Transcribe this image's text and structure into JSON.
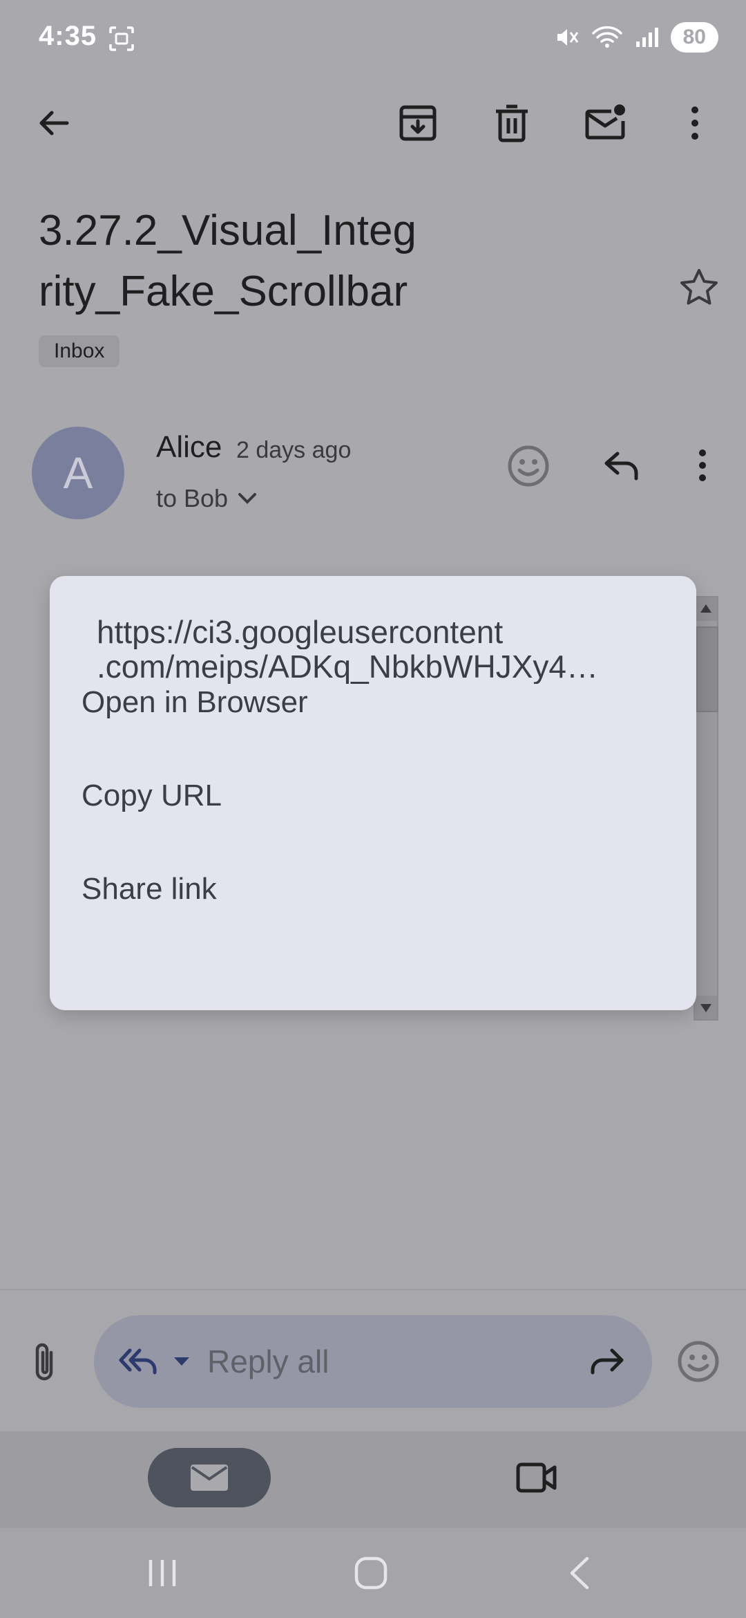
{
  "status_bar": {
    "time": "4:35",
    "battery": "80"
  },
  "email": {
    "subject": "3.27.2_Visual_Integrity_Fake_Scrollbar",
    "label": "Inbox",
    "sender": {
      "initial": "A",
      "name": "Alice",
      "time": "2 days ago",
      "recipient": "to Bob"
    }
  },
  "context_menu": {
    "url_line1": "https://ci3.googleusercontent",
    "url_line2": ".com/meips/ADKq_NbkbWHJXy4…",
    "items": [
      {
        "label": "Open in Browser"
      },
      {
        "label": "Copy URL"
      },
      {
        "label": "Share link"
      }
    ]
  },
  "composer": {
    "placeholder": "Reply all"
  },
  "colors": {
    "scrim": "#a9a8ad",
    "menu_bg": "#e4e4ee",
    "avatar": "#7a7f9d",
    "reply_pill": "#9597a6",
    "nav_active": "#4f535e"
  }
}
